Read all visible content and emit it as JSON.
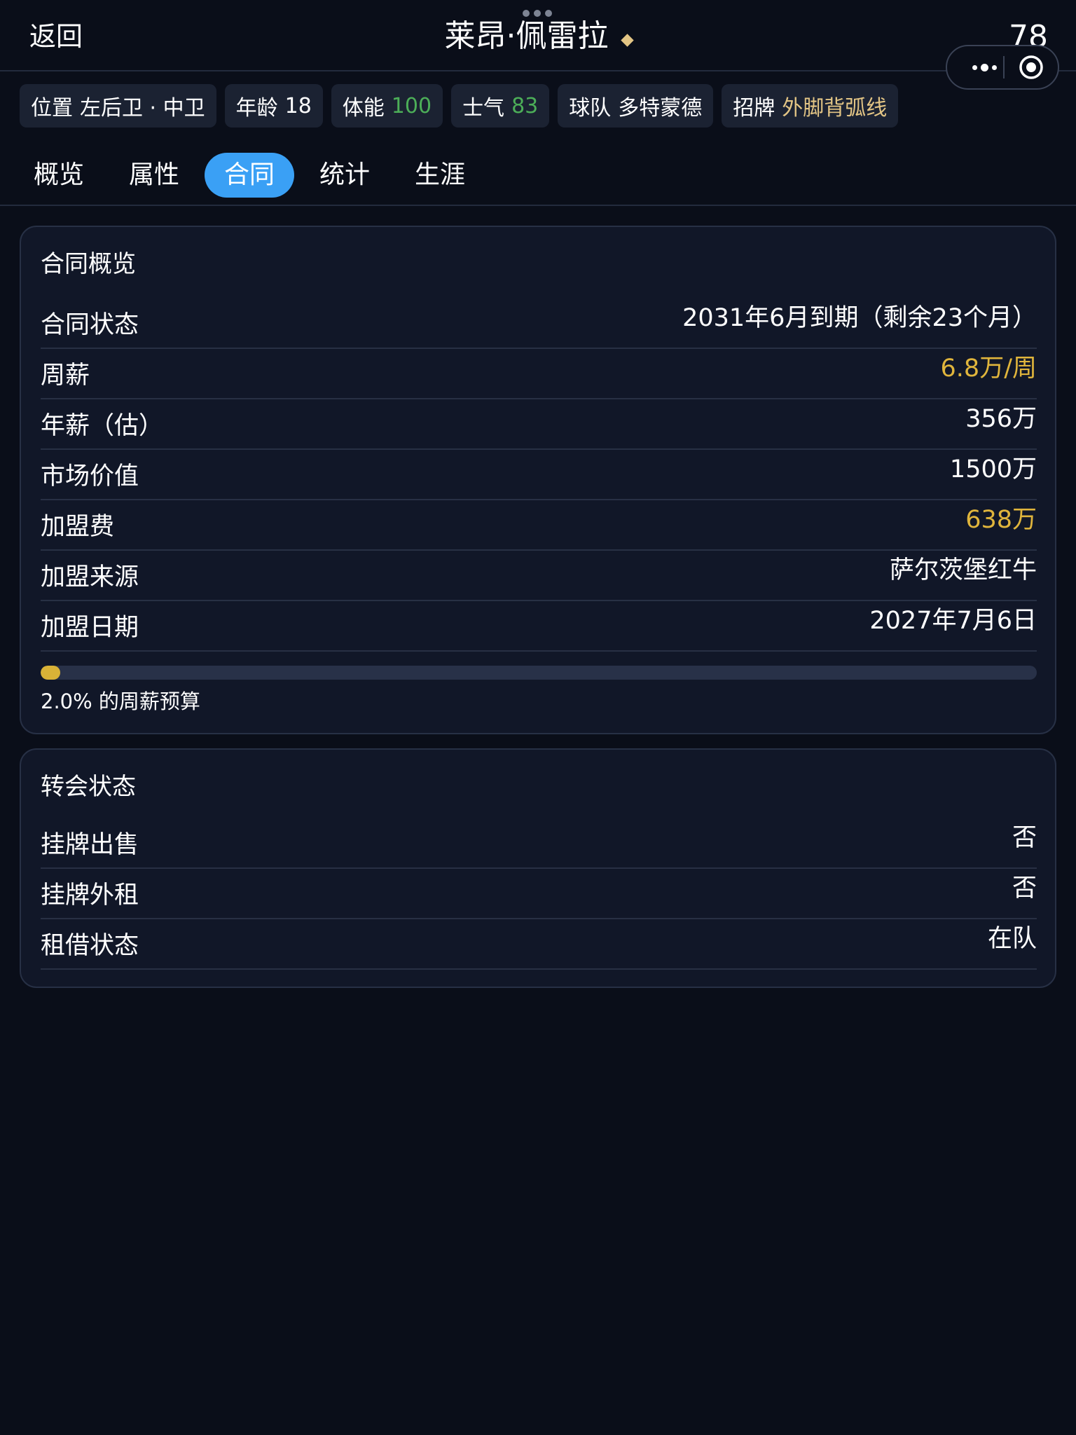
{
  "header": {
    "back_label": "返回",
    "title": "莱昂·佩雷拉",
    "rating": "78"
  },
  "tags": [
    {
      "label": "位置",
      "value": "左后卫 · 中卫",
      "value_color": "white"
    },
    {
      "label": "年龄",
      "value": "18",
      "value_color": "white"
    },
    {
      "label": "体能",
      "value": "100",
      "value_color": "green"
    },
    {
      "label": "士气",
      "value": "83",
      "value_color": "green"
    },
    {
      "label": "球队",
      "value": "多特蒙德",
      "value_color": "white"
    },
    {
      "label": "招牌",
      "value": "外脚背弧线",
      "value_color": "gold"
    }
  ],
  "tabs": [
    {
      "label": "概览",
      "active": false
    },
    {
      "label": "属性",
      "active": false
    },
    {
      "label": "合同",
      "active": true
    },
    {
      "label": "统计",
      "active": false
    },
    {
      "label": "生涯",
      "active": false
    }
  ],
  "contract": {
    "title": "合同概览",
    "rows": [
      {
        "key": "合同状态",
        "value": "2031年6月到期（剩余23个月）",
        "highlight": false
      },
      {
        "key": "周薪",
        "value": "6.8万/周",
        "highlight": true
      },
      {
        "key": "年薪（估）",
        "value": "356万",
        "highlight": false
      },
      {
        "key": "市场价值",
        "value": "1500万",
        "highlight": false
      },
      {
        "key": "加盟费",
        "value": "638万",
        "highlight": true
      },
      {
        "key": "加盟来源",
        "value": "萨尔茨堡红牛",
        "highlight": false
      },
      {
        "key": "加盟日期",
        "value": "2027年7月6日",
        "highlight": false
      }
    ],
    "budget_percent": 2.0,
    "budget_label": "2.0% 的周薪预算"
  },
  "transfer": {
    "title": "转会状态",
    "rows": [
      {
        "key": "挂牌出售",
        "value": "否"
      },
      {
        "key": "挂牌外租",
        "value": "否"
      },
      {
        "key": "租借状态",
        "value": "在队"
      }
    ]
  },
  "colors": {
    "background": "#0a0e19",
    "card": "#111728",
    "accent_blue": "#3aa0f5",
    "gold": "#e0b53c",
    "green": "#4cae58",
    "tag_gold": "#e3c585"
  }
}
